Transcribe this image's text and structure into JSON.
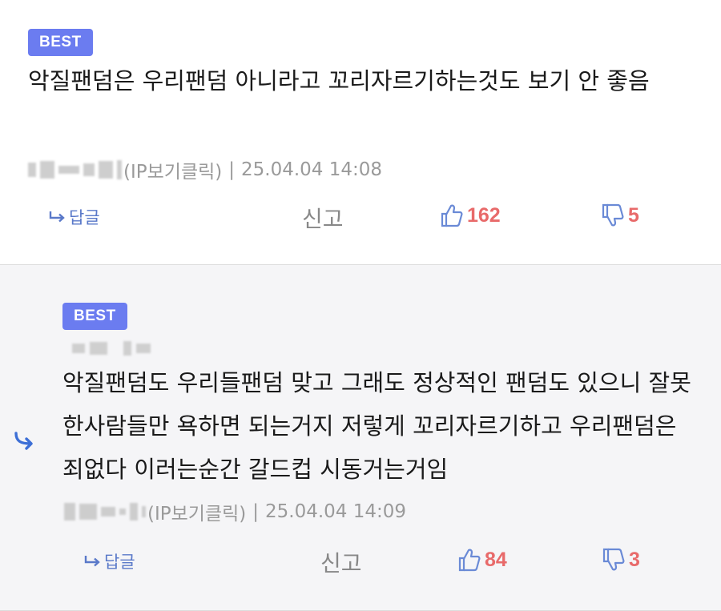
{
  "colors": {
    "best_badge": "#6b7cf0",
    "reply_link": "#5a79c9",
    "vote_count": "#e86a6a",
    "meta_text": "#9a9a9a",
    "reply_bg": "#f5f5f7"
  },
  "comments": [
    {
      "badge": "BEST",
      "text": "악질팬덤은 우리팬덤 아니라고 꼬리자르기하는것도 보기 안 좋음",
      "ip_label": "(IP보기클릭)",
      "separator": "|",
      "timestamp": "25.04.04 14:08",
      "reply_label": "답글",
      "report_label": "신고",
      "upvotes": "162",
      "downvotes": "5",
      "icons": [
        "reply-arrow-icon",
        "thumbs-up-icon",
        "thumbs-down-icon"
      ]
    },
    {
      "badge": "BEST",
      "text": "악질팬덤도 우리들팬덤 맞고 그래도 정상적인 팬덤도 있으니 잘못한사람들만 욕하면 되는거지 저렇게 꼬리자르기하고 우리팬덤은 죄없다 이러는순간 갈드컵 시동거는거임",
      "ip_label": "(IP보기클릭)",
      "separator": "|",
      "timestamp": "25.04.04 14:09",
      "reply_label": "답글",
      "report_label": "신고",
      "upvotes": "84",
      "downvotes": "3",
      "is_reply": true,
      "icons": [
        "nested-reply-icon",
        "reply-arrow-icon",
        "thumbs-up-icon",
        "thumbs-down-icon"
      ]
    }
  ]
}
